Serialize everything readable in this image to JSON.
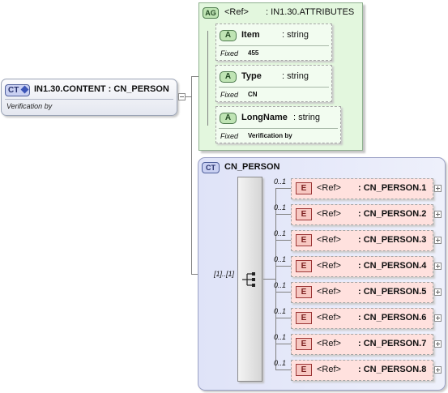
{
  "root": {
    "badge": "CT",
    "title": "IN1.30.CONTENT : CN_PERSON",
    "documentation": "Verification by"
  },
  "attribute_group": {
    "badge": "AG",
    "ref": "<Ref>",
    "name": ": IN1.30.ATTRIBUTES",
    "attributes": [
      {
        "badge": "A",
        "name": "Item",
        "type": ": string",
        "fixed_label": "Fixed",
        "fixed_value": "455"
      },
      {
        "badge": "A",
        "name": "Type",
        "type": ": string",
        "fixed_label": "Fixed",
        "fixed_value": "CN"
      },
      {
        "badge": "A",
        "name": "LongName",
        "type": ": string",
        "fixed_label": "Fixed",
        "fixed_value": "Verification by"
      }
    ]
  },
  "complex_type": {
    "badge": "CT",
    "title": "CN_PERSON",
    "sequence_occurrence": "[1]..[1]",
    "elements": [
      {
        "badge": "E",
        "occurrence": "0..1",
        "ref": "<Ref>",
        "name": ": CN_PERSON.1"
      },
      {
        "badge": "E",
        "occurrence": "0..1",
        "ref": "<Ref>",
        "name": ": CN_PERSON.2"
      },
      {
        "badge": "E",
        "occurrence": "0..1",
        "ref": "<Ref>",
        "name": ": CN_PERSON.3"
      },
      {
        "badge": "E",
        "occurrence": "0..1",
        "ref": "<Ref>",
        "name": ": CN_PERSON.4"
      },
      {
        "badge": "E",
        "occurrence": "0..1",
        "ref": "<Ref>",
        "name": ": CN_PERSON.5"
      },
      {
        "badge": "E",
        "occurrence": "0..1",
        "ref": "<Ref>",
        "name": ": CN_PERSON.6"
      },
      {
        "badge": "E",
        "occurrence": "0..1",
        "ref": "<Ref>",
        "name": ": CN_PERSON.7"
      },
      {
        "badge": "E",
        "occurrence": "0..1",
        "ref": "<Ref>",
        "name": ": CN_PERSON.8"
      }
    ]
  },
  "colors": {
    "element_fill": "#ffe1de",
    "attribute_group_fill": "#e3f7de",
    "complex_type_fill": "#dfe3f8"
  },
  "icons": {
    "root_badge_icon": "diamond-icon",
    "sequence_icon": "sequence-compositor-icon",
    "expand_icon": "plus-icon",
    "collapse_icon": "minus-icon"
  }
}
